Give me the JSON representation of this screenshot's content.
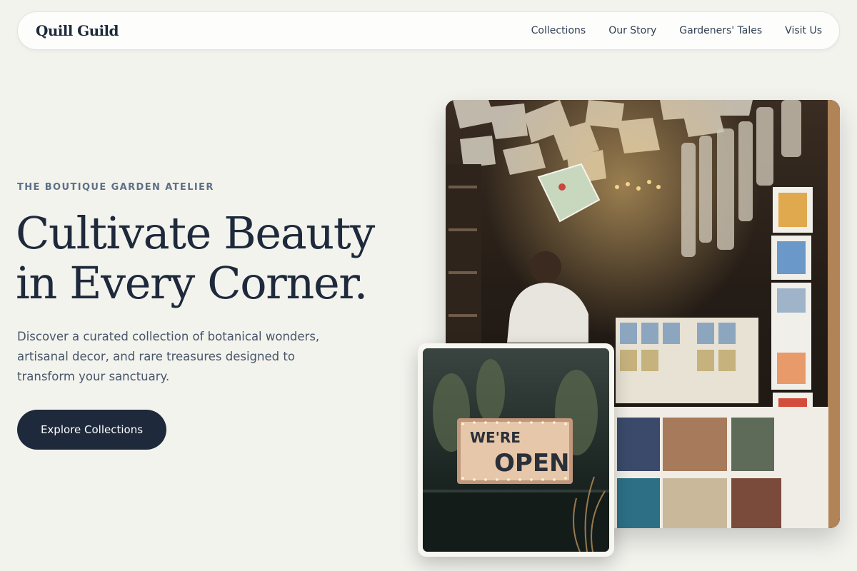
{
  "brand": {
    "name": "Quill Guild"
  },
  "nav": {
    "links": [
      {
        "label": "Collections"
      },
      {
        "label": "Our Story"
      },
      {
        "label": "Gardeners' Tales"
      },
      {
        "label": "Visit Us"
      }
    ]
  },
  "hero": {
    "eyebrow": "THE BOUTIQUE GARDEN ATELIER",
    "headline_line1": "Cultivate Beauty",
    "headline_line2": "in Every Corner.",
    "description": "Discover a curated collection of botanical wonders, artisanal decor, and rare treasures designed to transform your sanctuary.",
    "cta_label": "Explore Collections"
  },
  "images": {
    "main": {
      "subject": "bookshop-interior-photo"
    },
    "inset": {
      "subject": "open-sign-photo",
      "sign_line1": "WE'RE",
      "sign_line2": "OPEN"
    }
  },
  "colors": {
    "page_bg": "#f3f3ee",
    "ink": "#1e293b",
    "eyebrow": "#5d6f86",
    "body_text": "#475569",
    "cta_bg": "#1e293b",
    "cta_text": "#ffffff"
  }
}
